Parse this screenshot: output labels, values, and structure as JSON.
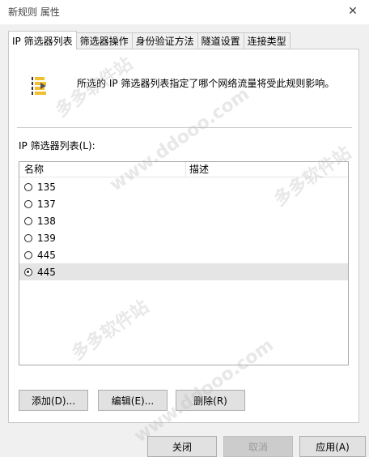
{
  "window": {
    "title": "新规则 属性"
  },
  "tabs": [
    {
      "label": "IP 筛选器列表",
      "active": true
    },
    {
      "label": "筛选器操作",
      "active": false
    },
    {
      "label": "身份验证方法",
      "active": false
    },
    {
      "label": "隧道设置",
      "active": false
    },
    {
      "label": "连接类型",
      "active": false
    }
  ],
  "info": {
    "text": "所选的 IP 筛选器列表指定了哪个网络流量将受此规则影响。",
    "icon": "filter-list-icon"
  },
  "filter_list": {
    "label": "IP 筛选器列表(L):",
    "columns": [
      "名称",
      "描述"
    ],
    "rows": [
      {
        "name": "135",
        "selected": false
      },
      {
        "name": "137",
        "selected": false
      },
      {
        "name": "138",
        "selected": false
      },
      {
        "name": "139",
        "selected": false
      },
      {
        "name": "445",
        "selected": false
      },
      {
        "name": "445",
        "selected": true
      }
    ]
  },
  "actions": {
    "add": "添加(D)...",
    "edit": "编辑(E)...",
    "delete": "删除(R)"
  },
  "footer": {
    "close": "关闭",
    "cancel": "取消",
    "apply": "应用(A)"
  },
  "watermark": {
    "text1": "多多软件站",
    "text2": "www.ddooo.com"
  }
}
